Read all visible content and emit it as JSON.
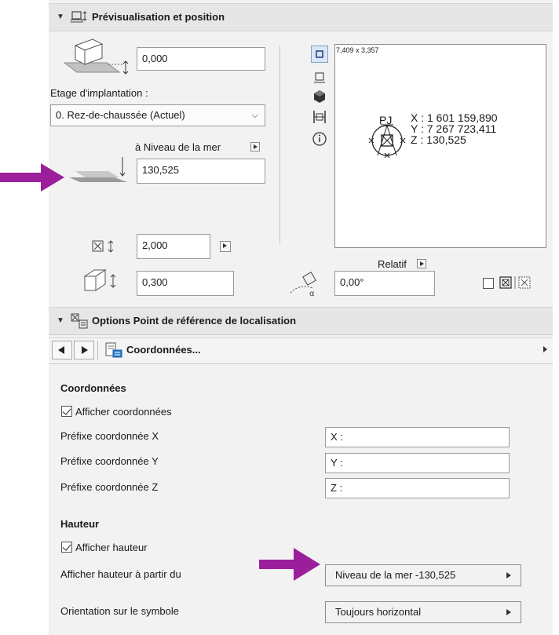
{
  "section1": {
    "title": "Prévisualisation et position"
  },
  "left": {
    "offset_value": "0,000",
    "story_label": "Etage d'implantation :",
    "story_select": "0. Rez-de-chaussée (Actuel)",
    "level_ref_label": "à Niveau de la mer",
    "level_value": "130,525",
    "size_value": "2,000",
    "thickness_value": "0,300"
  },
  "preview": {
    "size_text": "7,409 x 3,357",
    "point_label": "PJ",
    "coord_x": "X : 1 601 159,890",
    "coord_y": "Y : 7 267 723,411",
    "coord_z": "Z : 130,525"
  },
  "angle": {
    "relative_label": "Relatif",
    "value": "0,00°"
  },
  "section2": {
    "title": "Options Point de référence de localisation"
  },
  "nav": {
    "page_title": "Coordonnées..."
  },
  "coords": {
    "heading": "Coordonnées",
    "show_label": "Afficher coordonnées",
    "prefix_x_label": "Préfixe coordonnée X",
    "prefix_x_value": "X :",
    "prefix_y_label": "Préfixe coordonnée Y",
    "prefix_y_value": "Y :",
    "prefix_z_label": "Préfixe coordonnée Z",
    "prefix_z_value": "Z :"
  },
  "height": {
    "heading": "Hauteur",
    "show_label": "Afficher hauteur",
    "from_label": "Afficher hauteur à partir du",
    "from_value": "Niveau de la mer -130,525",
    "orientation_label": "Orientation sur le symbole",
    "orientation_value": "Toujours horizontal"
  },
  "colors": {
    "arrow": "#9b1f9b",
    "panel": "#f2f2f2",
    "header": "#e6e6e6"
  }
}
